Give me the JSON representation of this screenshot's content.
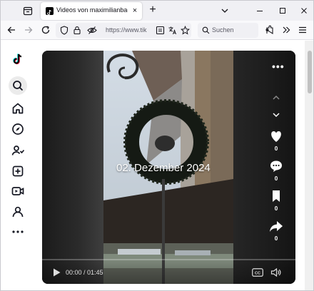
{
  "browser": {
    "tab_title": "Videos von maximilianbaehring",
    "tab_close": "×",
    "new_tab": "+",
    "url": "https://www.tik",
    "search_placeholder": "Suchen"
  },
  "video": {
    "overlay_text": "02. Dezember 2024",
    "more": "•••",
    "time": "00:00 / 01:45",
    "progress": 0,
    "actions": [
      {
        "icon": "heart-icon",
        "count": "0"
      },
      {
        "icon": "comment-icon",
        "count": "0"
      },
      {
        "icon": "bookmark-icon",
        "count": "0"
      },
      {
        "icon": "share-icon",
        "count": "0"
      }
    ]
  }
}
